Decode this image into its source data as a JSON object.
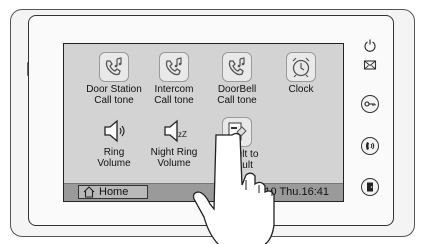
{
  "tiles": [
    {
      "label1": "Door Station",
      "label2": "Call tone",
      "icon": "phone-note-icon"
    },
    {
      "label1": "Intercom",
      "label2": "Call tone",
      "icon": "phone-note-icon"
    },
    {
      "label1": "DoorBell",
      "label2": "Call tone",
      "icon": "phone-note-icon"
    },
    {
      "label1": "Clock",
      "label2": "",
      "icon": "alarm-clock-icon"
    },
    {
      "label1": "Ring",
      "label2": "Volume",
      "icon": "speaker-icon"
    },
    {
      "label1": "Night Ring",
      "label2": "Volume",
      "icon": "speaker-night-icon"
    },
    {
      "label1": "Refault to",
      "label2": "Default",
      "icon": "reset-default-icon"
    }
  ],
  "status_bar": {
    "home_label": "Home",
    "datetime": "09/30/2010  Thu.16:41"
  },
  "side_buttons": [
    "power-icon",
    "mail-icon",
    "key-icon",
    "talk-icon",
    "door-icon"
  ]
}
